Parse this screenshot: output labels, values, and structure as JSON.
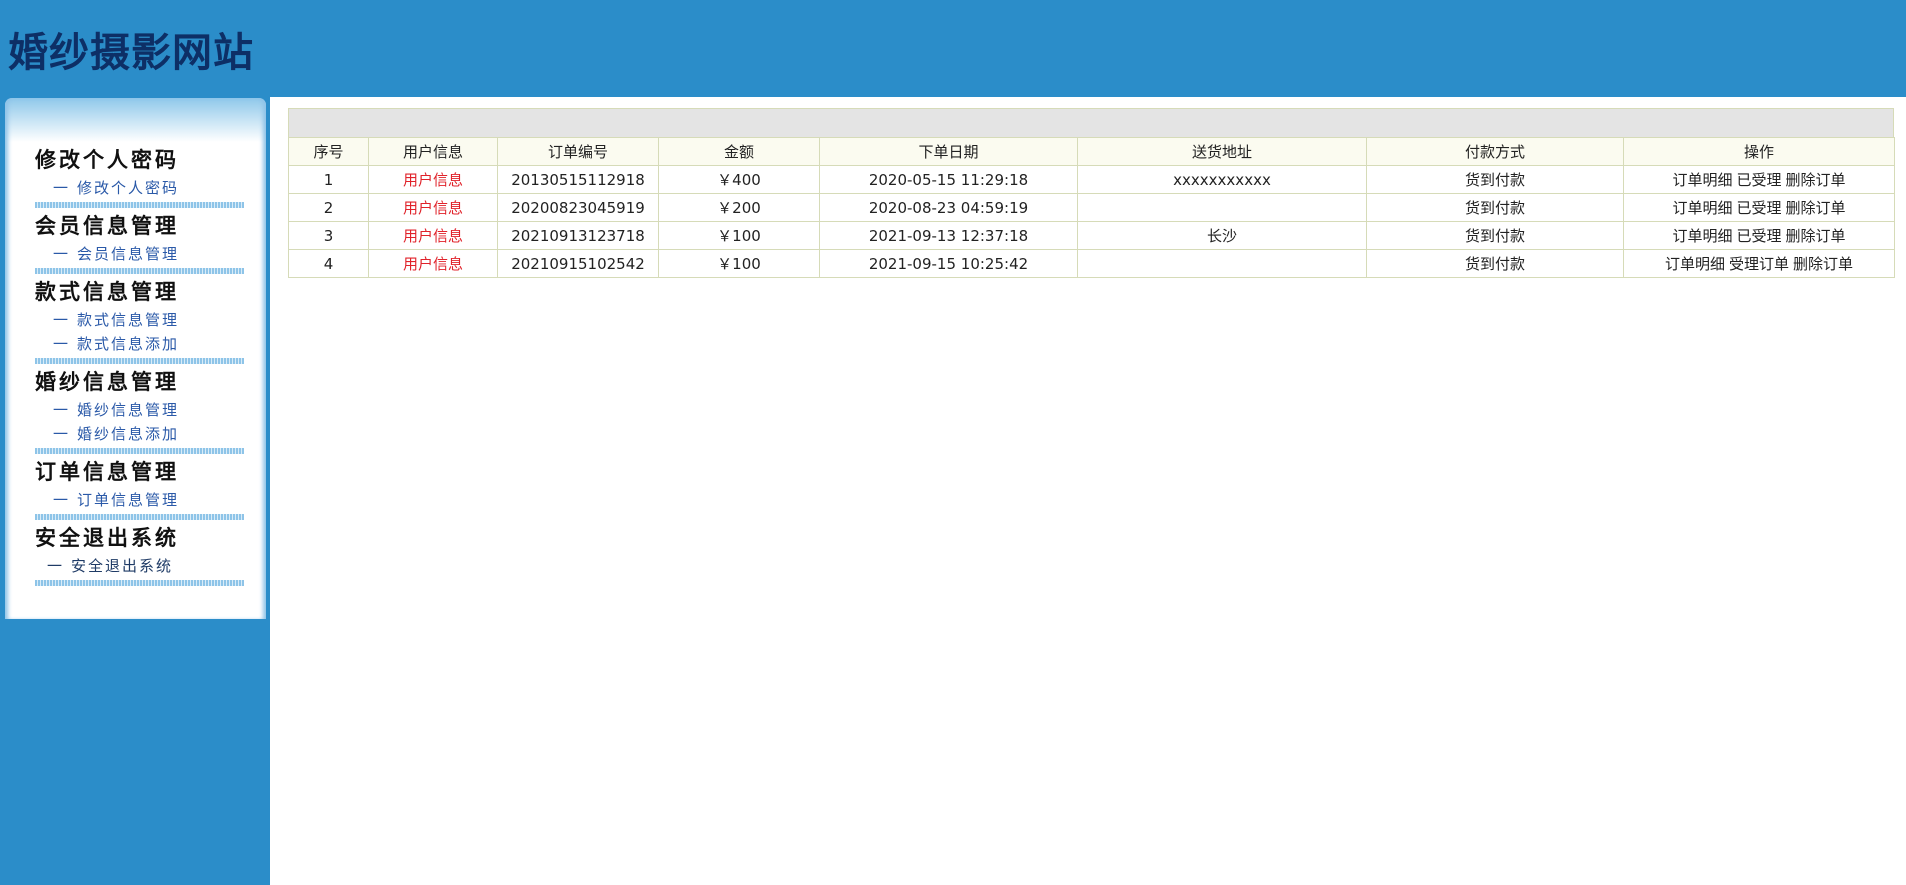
{
  "header": {
    "title": "婚纱摄影网站"
  },
  "sidebar": {
    "groups": [
      {
        "title": "修改个人密码",
        "items": [
          {
            "label": "修改个人密码"
          }
        ]
      },
      {
        "title": "会员信息管理",
        "items": [
          {
            "label": "会员信息管理"
          }
        ]
      },
      {
        "title": "款式信息管理",
        "items": [
          {
            "label": "款式信息管理"
          },
          {
            "label": "款式信息添加"
          }
        ]
      },
      {
        "title": "婚纱信息管理",
        "items": [
          {
            "label": "婚纱信息管理"
          },
          {
            "label": "婚纱信息添加"
          }
        ]
      },
      {
        "title": "订单信息管理",
        "items": [
          {
            "label": "订单信息管理"
          }
        ]
      },
      {
        "title": "安全退出系统",
        "items": [
          {
            "label": "安全退出系统"
          }
        ]
      }
    ],
    "dash": "一"
  },
  "table": {
    "columns": [
      "序号",
      "用户信息",
      "订单编号",
      "金额",
      "下单日期",
      "送货地址",
      "付款方式",
      "操作"
    ],
    "rows": [
      {
        "index": "1",
        "user": "用户信息",
        "order_no": "20130515112918",
        "amount": "￥400",
        "date": "2020-05-15 11:29:18",
        "address": "xxxxxxxxxxx",
        "payment": "货到付款",
        "ops": [
          "订单明细",
          "已受理",
          "删除订单"
        ]
      },
      {
        "index": "2",
        "user": "用户信息",
        "order_no": "20200823045919",
        "amount": "￥200",
        "date": "2020-08-23 04:59:19",
        "address": "",
        "payment": "货到付款",
        "ops": [
          "订单明细",
          "已受理",
          "删除订单"
        ]
      },
      {
        "index": "3",
        "user": "用户信息",
        "order_no": "20210913123718",
        "amount": "￥100",
        "date": "2021-09-13 12:37:18",
        "address": "长沙",
        "payment": "货到付款",
        "ops": [
          "订单明细",
          "已受理",
          "删除订单"
        ]
      },
      {
        "index": "4",
        "user": "用户信息",
        "order_no": "20210915102542",
        "amount": "￥100",
        "date": "2021-09-15 10:25:42",
        "address": "",
        "payment": "货到付款",
        "ops": [
          "订单明细",
          "受理订单",
          "删除订单"
        ]
      }
    ]
  }
}
